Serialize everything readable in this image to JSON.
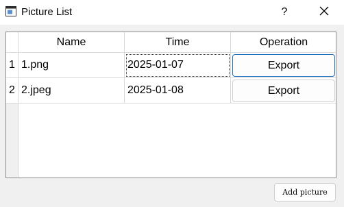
{
  "window": {
    "title": "Picture List",
    "help_label": "?",
    "icons": {
      "app": "picture-list-app-icon",
      "close": "close-icon"
    }
  },
  "table": {
    "columns": [
      "Name",
      "Time",
      "Operation"
    ],
    "rows": [
      {
        "row_number": "1",
        "name": "1.png",
        "time": "2025-01-07",
        "action_label": "Export"
      },
      {
        "row_number": "2",
        "name": "2.jpeg",
        "time": "2025-01-08",
        "action_label": "Export"
      }
    ]
  },
  "footer": {
    "add_label": "Add picture"
  },
  "colors": {
    "focus_border": "#1f6fbf",
    "background": "#f0f0f0"
  }
}
